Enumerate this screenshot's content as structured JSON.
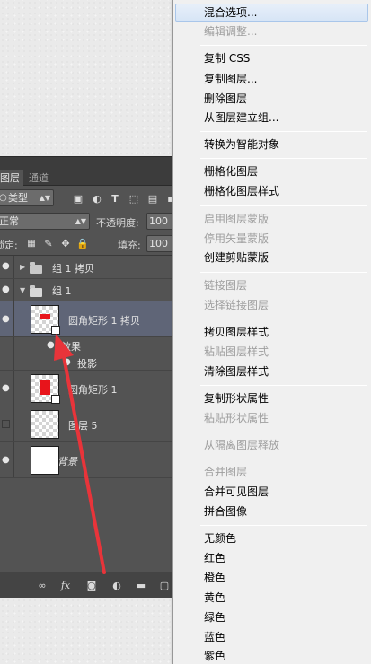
{
  "panel": {
    "tabs": [
      "图层",
      "通道"
    ],
    "filter_label": "类型",
    "blend_mode": "正常",
    "opacity_label": "不透明度:",
    "opacity_value": "100",
    "lock_label": "锁定:",
    "fill_label": "填充:",
    "fill_value": "100",
    "filter_tools": [
      "image-filter-icon",
      "adjust-filter-icon",
      "text-filter-icon",
      "shape-filter-icon",
      "smart-object-filter-icon"
    ],
    "layers": [
      {
        "name": "组 1 拷贝",
        "kind": "group",
        "expanded": false,
        "visible": true
      },
      {
        "name": "组 1",
        "kind": "group",
        "expanded": true,
        "visible": true
      },
      {
        "name": "圆角矩形 1 拷贝",
        "kind": "shape",
        "visible": true,
        "selected": true
      },
      {
        "name": "效果",
        "kind": "effects",
        "visible": true
      },
      {
        "name": "投影",
        "kind": "effect",
        "visible": true
      },
      {
        "name": "圆角矩形 1",
        "kind": "shape",
        "visible": true
      },
      {
        "name": "图层 5",
        "kind": "pixel",
        "visible": false
      },
      {
        "name": "背景",
        "kind": "background",
        "visible": true
      }
    ],
    "bottom_tools": [
      "link-icon",
      "fx-icon",
      "mask-icon",
      "adjustment-icon",
      "new-group-icon",
      "new-layer-icon"
    ],
    "fx_label": "fx"
  },
  "menu": {
    "groups": [
      [
        {
          "label": "混合选项...",
          "enabled": true,
          "highlighted": true
        },
        {
          "label": "编辑调整...",
          "enabled": false
        }
      ],
      [
        {
          "label": "复制 CSS",
          "enabled": true
        },
        {
          "label": "复制图层...",
          "enabled": true
        },
        {
          "label": "删除图层",
          "enabled": true
        },
        {
          "label": "从图层建立组...",
          "enabled": true
        }
      ],
      [
        {
          "label": "转换为智能对象",
          "enabled": true
        }
      ],
      [
        {
          "label": "栅格化图层",
          "enabled": true
        },
        {
          "label": "栅格化图层样式",
          "enabled": true
        }
      ],
      [
        {
          "label": "启用图层蒙版",
          "enabled": false
        },
        {
          "label": "停用矢量蒙版",
          "enabled": false
        },
        {
          "label": "创建剪贴蒙版",
          "enabled": true
        }
      ],
      [
        {
          "label": "链接图层",
          "enabled": false
        },
        {
          "label": "选择链接图层",
          "enabled": false
        }
      ],
      [
        {
          "label": "拷贝图层样式",
          "enabled": true
        },
        {
          "label": "粘贴图层样式",
          "enabled": false
        },
        {
          "label": "清除图层样式",
          "enabled": true
        }
      ],
      [
        {
          "label": "复制形状属性",
          "enabled": true
        },
        {
          "label": "粘贴形状属性",
          "enabled": false
        }
      ],
      [
        {
          "label": "从隔离图层释放",
          "enabled": false
        }
      ],
      [
        {
          "label": "合并图层",
          "enabled": false
        },
        {
          "label": "合并可见图层",
          "enabled": true
        },
        {
          "label": "拼合图像",
          "enabled": true
        }
      ],
      [
        {
          "label": "无颜色",
          "enabled": true
        },
        {
          "label": "红色",
          "enabled": true
        },
        {
          "label": "橙色",
          "enabled": true
        },
        {
          "label": "黄色",
          "enabled": true
        },
        {
          "label": "绿色",
          "enabled": true
        },
        {
          "label": "蓝色",
          "enabled": true
        },
        {
          "label": "紫色",
          "enabled": true
        }
      ]
    ]
  },
  "colors": {
    "annotation_arrow": "#e8343a",
    "shape_fill": "#e8141b",
    "selected_layer": "#5f6577"
  }
}
